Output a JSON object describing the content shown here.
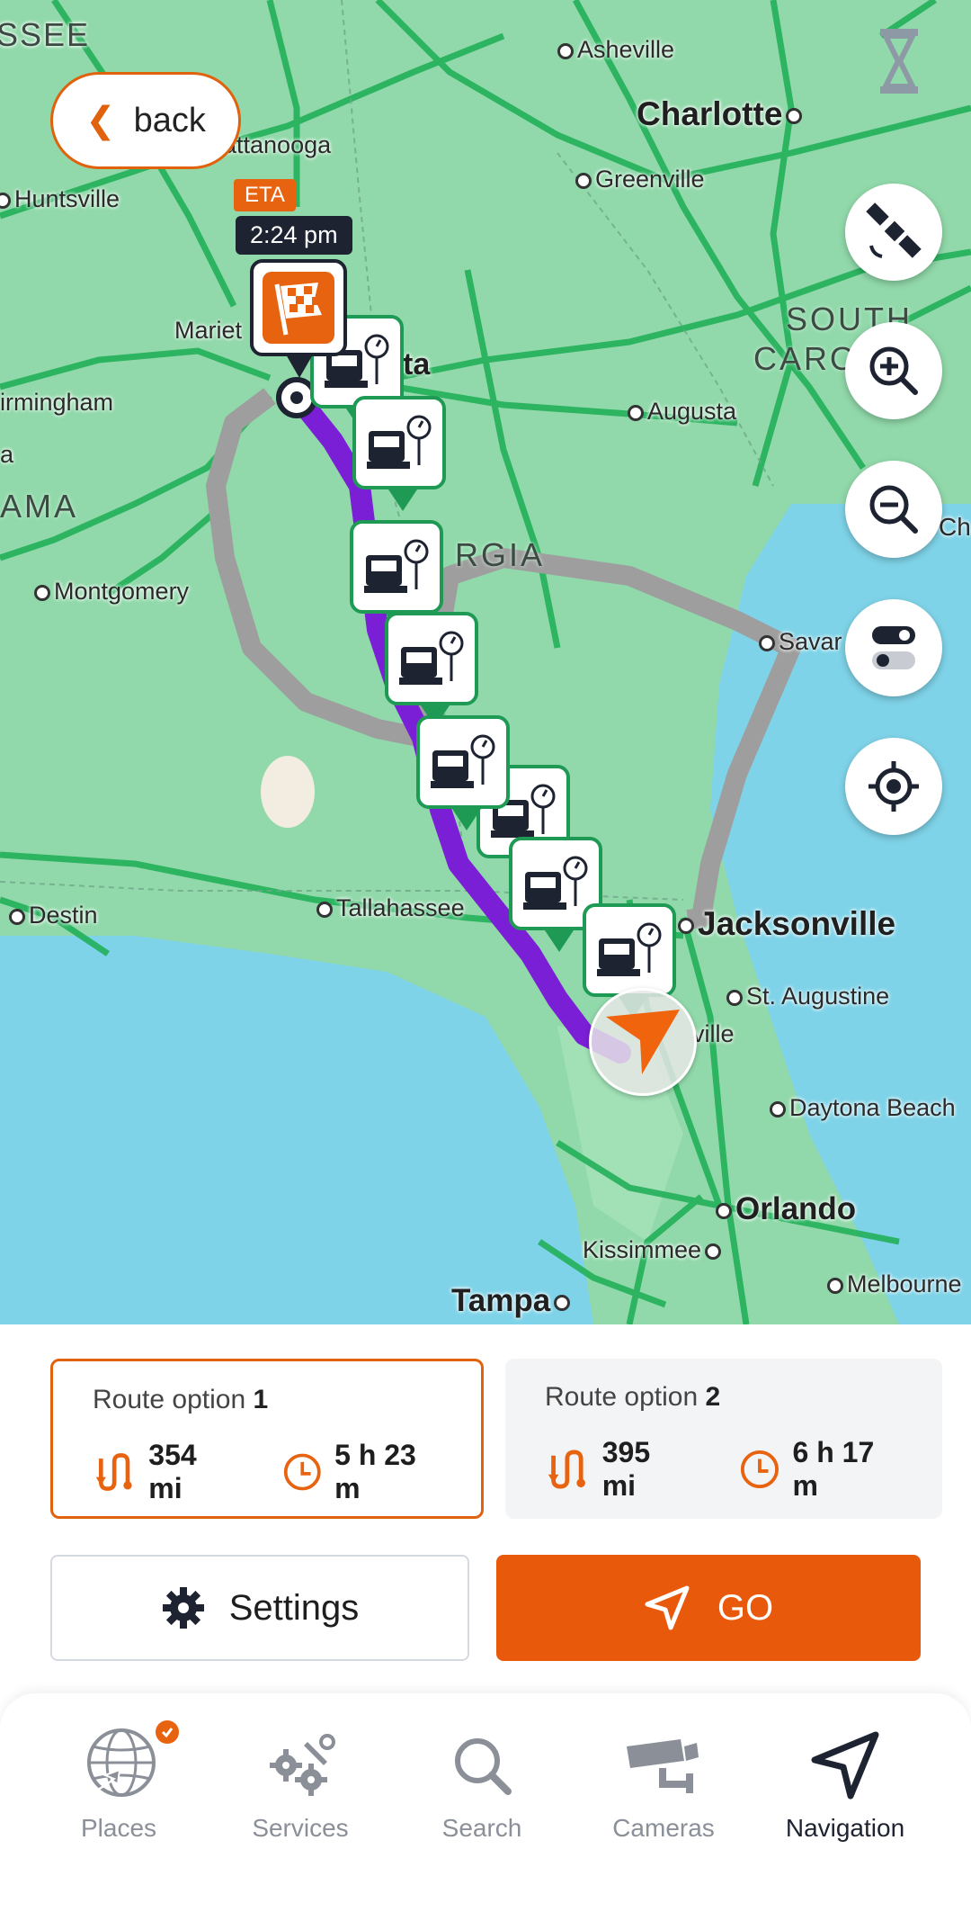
{
  "map": {
    "cities": {
      "tennessee_fragment": "SSEE",
      "asheville": "Asheville",
      "charlotte": "Charlotte",
      "chattanooga_fragment": "attanooga",
      "huntsville": "Huntsville",
      "greenville": "Greenville",
      "marietta_fragment": "Mariet",
      "atlanta_fragment": "ta",
      "birmingham_fragment": "irmingham",
      "augusta": "Augusta",
      "alabama_fragment": "AMA",
      "montgomery": "Montgomery",
      "savannah_fragment": "Savar",
      "charleston_fragment": "Ch",
      "destin": "Destin",
      "tallahassee": "Tallahassee",
      "jacksonville": "Jacksonville",
      "st_augustine": "St. Augustine",
      "gainesville_fragment": "ville",
      "daytona": "Daytona Beach",
      "orlando": "Orlando",
      "kissimmee": "Kissimmee",
      "tampa": "Tampa",
      "melbourne": "Melbourne",
      "a_fragment": "a"
    },
    "states": {
      "south_carolina_1": "SOUTH",
      "south_carolina_2": "CARO",
      "georgia_fragment": "RGIA"
    },
    "eta_label": "ETA",
    "eta_time": "2:24 pm"
  },
  "back_button": {
    "label": "back"
  },
  "routes": [
    {
      "label": "Route option",
      "number": "1",
      "distance": "354 mi",
      "duration": "5 h 23 m",
      "selected": true
    },
    {
      "label": "Route option",
      "number": "2",
      "distance": "395 mi",
      "duration": "6 h 17 m",
      "selected": false
    }
  ],
  "actions": {
    "settings_label": "Settings",
    "go_label": "GO"
  },
  "bottom_nav": [
    {
      "label": "Places",
      "icon": "globe-plane-icon",
      "badge": true
    },
    {
      "label": "Services",
      "icon": "gears-icon"
    },
    {
      "label": "Search",
      "icon": "search-icon"
    },
    {
      "label": "Cameras",
      "icon": "camera-icon"
    },
    {
      "label": "Navigation",
      "icon": "navigation-arrow-icon",
      "active": true
    }
  ],
  "colors": {
    "accent": "#e8590c",
    "truck_stop_green": "#1e9a55",
    "route_primary": "#7b1fd6",
    "route_alt": "#9e9e9e",
    "map_land": "#8fd8a8",
    "water": "#7fd3e8"
  }
}
